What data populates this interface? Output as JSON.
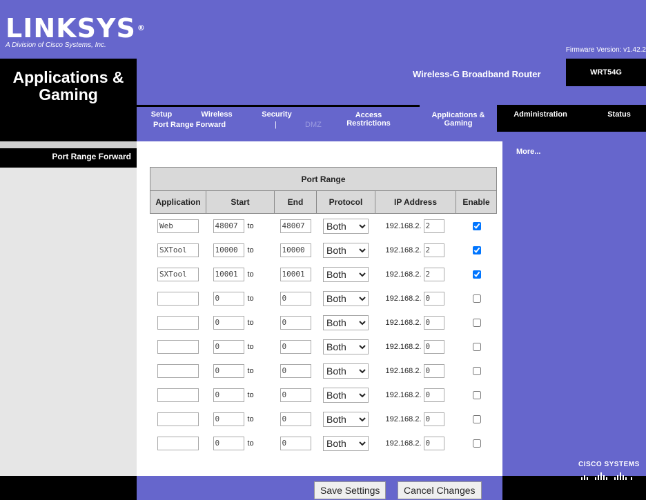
{
  "brand": {
    "logo": "LINKSYS",
    "reg_mark": "®",
    "subtitle": "A Division of Cisco Systems, Inc.",
    "firmware": "Firmware Version: v1.42.2"
  },
  "header": {
    "section_title": "Applications & Gaming",
    "product_name": "Wireless-G Broadband Router",
    "model": "WRT54G"
  },
  "tabs": [
    {
      "label": "Setup"
    },
    {
      "label": "Wireless"
    },
    {
      "label": "Security"
    },
    {
      "label": "Access Restrictions"
    },
    {
      "label": "Applications & Gaming",
      "active": true
    },
    {
      "label": "Administration"
    },
    {
      "label": "Status"
    }
  ],
  "subnav": {
    "port_range_forward": "Port Range Forward",
    "separator": "|",
    "dmz": "DMZ"
  },
  "sidebar": {
    "label": "Port Range Forward",
    "more": "More..."
  },
  "table": {
    "caption": "Port Range",
    "headers": {
      "application": "Application",
      "start": "Start",
      "end": "End",
      "protocol": "Protocol",
      "ip": "IP Address",
      "enable": "Enable"
    },
    "to_label": "to",
    "ip_prefix": "192.168.2.",
    "rows": [
      {
        "app": "Web",
        "start": "48007",
        "end": "48007",
        "protocol": "Both",
        "ip_last": "2",
        "enabled": true
      },
      {
        "app": "SXTool",
        "start": "10000",
        "end": "10000",
        "protocol": "Both",
        "ip_last": "2",
        "enabled": true
      },
      {
        "app": "SXTool",
        "start": "10001",
        "end": "10001",
        "protocol": "Both",
        "ip_last": "2",
        "enabled": true
      },
      {
        "app": "",
        "start": "0",
        "end": "0",
        "protocol": "Both",
        "ip_last": "0",
        "enabled": false
      },
      {
        "app": "",
        "start": "0",
        "end": "0",
        "protocol": "Both",
        "ip_last": "0",
        "enabled": false
      },
      {
        "app": "",
        "start": "0",
        "end": "0",
        "protocol": "Both",
        "ip_last": "0",
        "enabled": false
      },
      {
        "app": "",
        "start": "0",
        "end": "0",
        "protocol": "Both",
        "ip_last": "0",
        "enabled": false
      },
      {
        "app": "",
        "start": "0",
        "end": "0",
        "protocol": "Both",
        "ip_last": "0",
        "enabled": false
      },
      {
        "app": "",
        "start": "0",
        "end": "0",
        "protocol": "Both",
        "ip_last": "0",
        "enabled": false
      },
      {
        "app": "",
        "start": "0",
        "end": "0",
        "protocol": "Both",
        "ip_last": "0",
        "enabled": false
      }
    ]
  },
  "buttons": {
    "save": "Save Settings",
    "cancel": "Cancel Changes"
  },
  "footer": {
    "cisco": "CISCO SYSTEMS"
  },
  "colors": {
    "purple": "#6666cc",
    "black": "#000000"
  }
}
